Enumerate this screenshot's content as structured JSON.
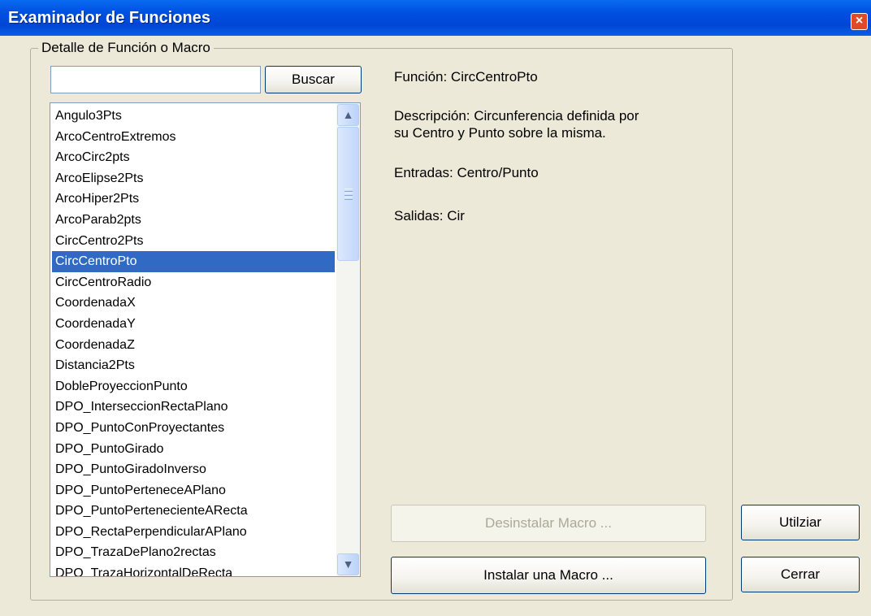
{
  "window": {
    "title": "Examinador de Funciones",
    "close_glyph": "×"
  },
  "group": {
    "label": "Detalle de Función o Macro"
  },
  "search": {
    "value": "",
    "placeholder": "",
    "button_label": "Buscar"
  },
  "list": {
    "selected": "CircCentroPto",
    "items": [
      "Angulo3Pts",
      "ArcoCentroExtremos",
      "ArcoCirc2pts",
      "ArcoElipse2Pts",
      "ArcoHiper2Pts",
      "ArcoParab2pts",
      "CircCentro2Pts",
      "CircCentroPto",
      "CircCentroRadio",
      "CoordenadaX",
      "CoordenadaY",
      "CoordenadaZ",
      "Distancia2Pts",
      "DobleProyeccionPunto",
      "DPO_InterseccionRectaPlano",
      "DPO_PuntoConProyectantes",
      "DPO_PuntoGirado",
      "DPO_PuntoGiradoInverso",
      "DPO_PuntoPerteneceAPlano",
      "DPO_PuntoPertenecienteARecta",
      "DPO_RectaPerpendicularAPlano",
      "DPO_TrazaDePlano2rectas",
      "DPO_TrazaHorizontalDeRecta"
    ]
  },
  "details": {
    "funcion": "Función: CircCentroPto",
    "descripcion_1": "Descripción: Circunferencia definida por",
    "descripcion_2": "su Centro y Punto sobre la misma.",
    "entradas": "Entradas: Centro/Punto",
    "salidas": "Salidas: Cir"
  },
  "buttons": {
    "uninstall": "Desinstalar Macro ...",
    "install": "Instalar una Macro ...",
    "use": "Utilziar",
    "close": "Cerrar"
  },
  "icons": {
    "scroll_up": "chevron-up-icon",
    "scroll_down": "chevron-down-icon",
    "close": "close-icon"
  }
}
